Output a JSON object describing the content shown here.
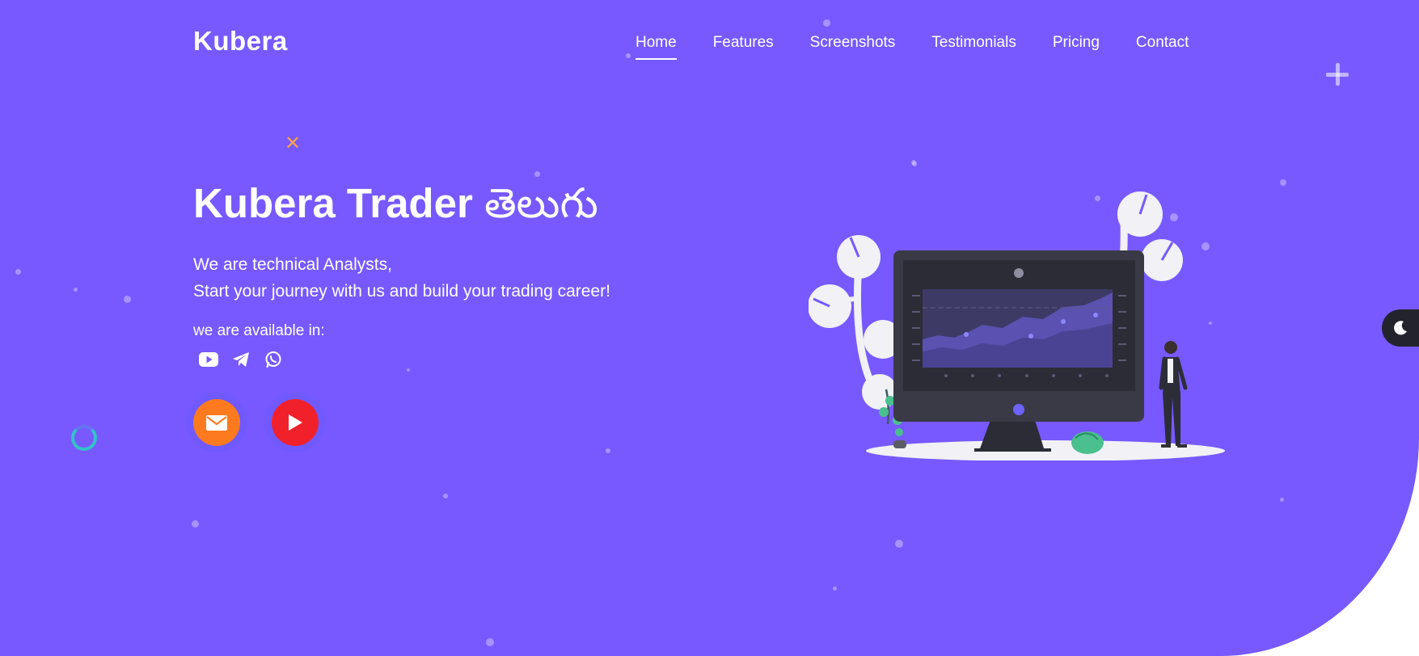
{
  "brand": {
    "logo": "Kubera"
  },
  "nav": {
    "items": [
      {
        "label": "Home",
        "active": true
      },
      {
        "label": "Features",
        "active": false
      },
      {
        "label": "Screenshots",
        "active": false
      },
      {
        "label": "Testimonials",
        "active": false
      },
      {
        "label": "Pricing",
        "active": false
      },
      {
        "label": "Contact",
        "active": false
      }
    ]
  },
  "hero": {
    "title_main": "Kubera Trader",
    "title_telugu": "తెలుగు",
    "subtitle_line1": "We are technical Analysts,",
    "subtitle_line2": "Start your journey with us and build your trading career!",
    "available_label": "we are available in:",
    "social_icons": [
      "youtube-icon",
      "telegram-icon",
      "whatsapp-icon"
    ],
    "cta_buttons": [
      "mail-icon",
      "play-icon"
    ]
  },
  "theme_toggle": {
    "icon": "moon-icon"
  },
  "colors": {
    "hero_bg": "#7759ff",
    "mail_button": "#fd7a1e",
    "play_button": "#f0212b",
    "toggle_bg": "#23232c",
    "accent_x": "#f6a34a",
    "ring": "#33c3c8"
  }
}
